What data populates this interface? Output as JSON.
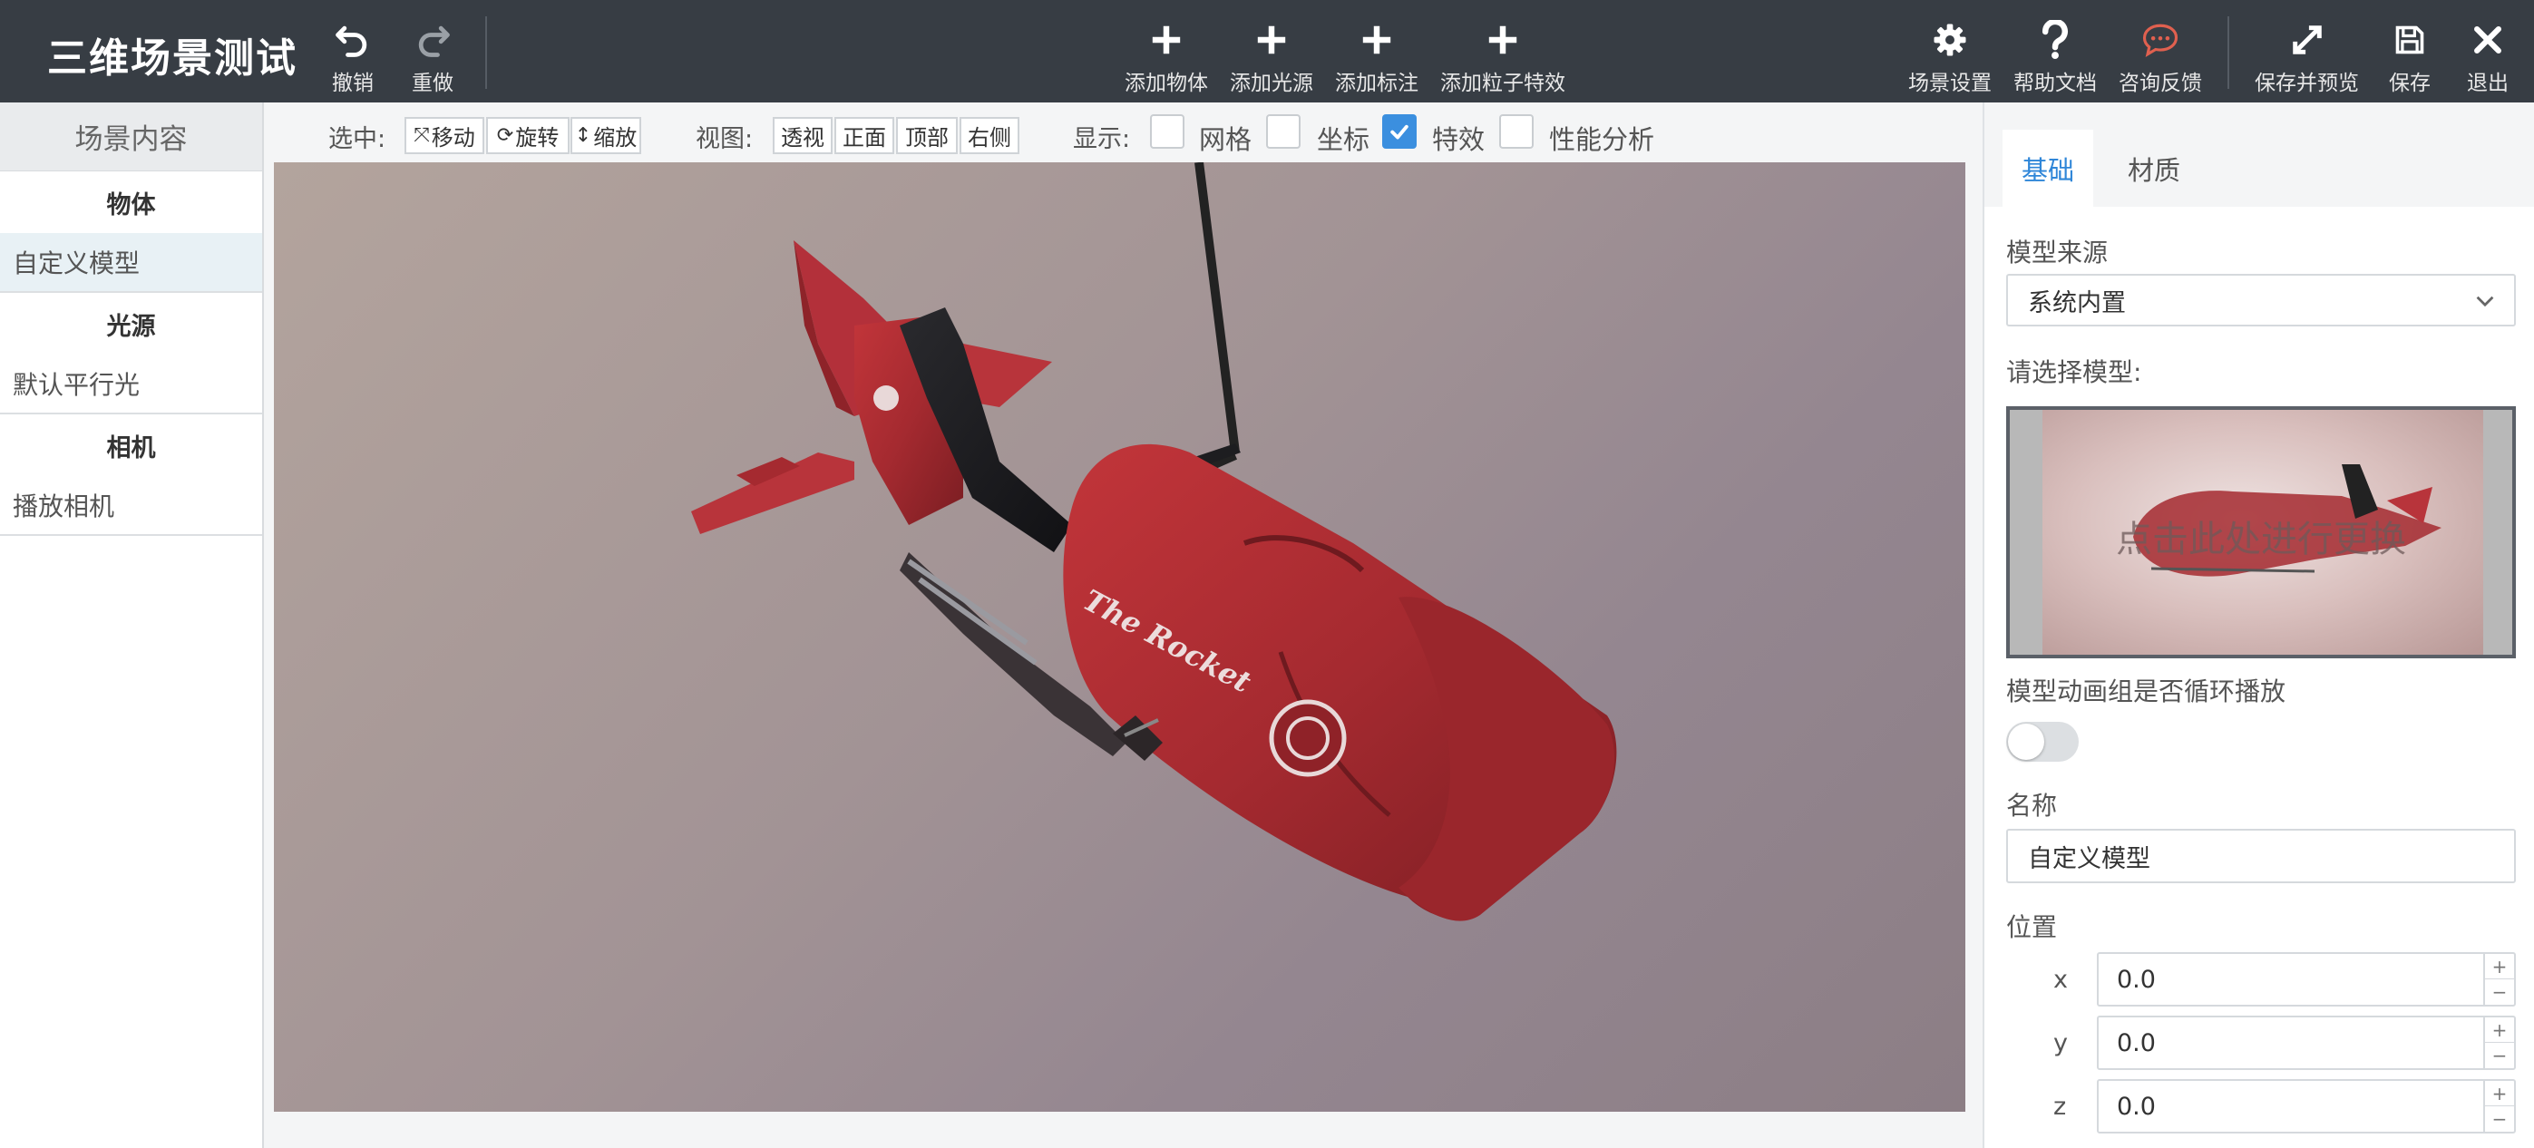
{
  "app": {
    "title": "三维场景测试"
  },
  "toolbar": {
    "undo": "撤销",
    "redo": "重做",
    "add_object": "添加物体",
    "add_light": "添加光源",
    "add_label": "添加标注",
    "add_particle": "添加粒子特效",
    "scene_settings": "场景设置",
    "help_docs": "帮助文档",
    "feedback": "咨询反馈",
    "save_preview": "保存并预览",
    "save": "保存",
    "exit": "退出"
  },
  "left_panel": {
    "title": "场景内容",
    "categories": [
      {
        "name": "物体",
        "items": [
          "自定义模型"
        ]
      },
      {
        "name": "光源",
        "items": [
          "默认平行光"
        ]
      },
      {
        "name": "相机",
        "items": [
          "播放相机"
        ]
      }
    ]
  },
  "view_toolbar": {
    "select_label": "选中:",
    "move": "移动",
    "rotate": "旋转",
    "scale": "缩放",
    "view_label": "视图:",
    "views": [
      "透视",
      "正面",
      "顶部",
      "右侧"
    ],
    "display_label": "显示:",
    "display_options": [
      {
        "label": "网格",
        "checked": false
      },
      {
        "label": "坐标",
        "checked": false
      },
      {
        "label": "特效",
        "checked": true
      },
      {
        "label": "性能分析",
        "checked": false
      }
    ]
  },
  "viewport": {
    "model_decal_text": "The Rocket"
  },
  "right_panel": {
    "tabs": [
      "基础",
      "材质"
    ],
    "active_tab": "基础",
    "model_source_label": "模型来源",
    "model_source_value": "系统内置",
    "choose_model_label": "请选择模型:",
    "click_to_replace": "点击此处进行更换",
    "loop_animation_label": "模型动画组是否循环播放",
    "loop_animation_on": false,
    "name_label": "名称",
    "name_value": "自定义模型",
    "position_label": "位置",
    "position": {
      "x": "0.0",
      "y": "0.0",
      "z": "0.0"
    }
  },
  "colors": {
    "topbar_bg": "#373d44",
    "accent_blue": "#2f86d8",
    "checkbox_on": "#3b8fdf",
    "model_red": "#a52a30",
    "feedback_icon": "#e0604f"
  }
}
